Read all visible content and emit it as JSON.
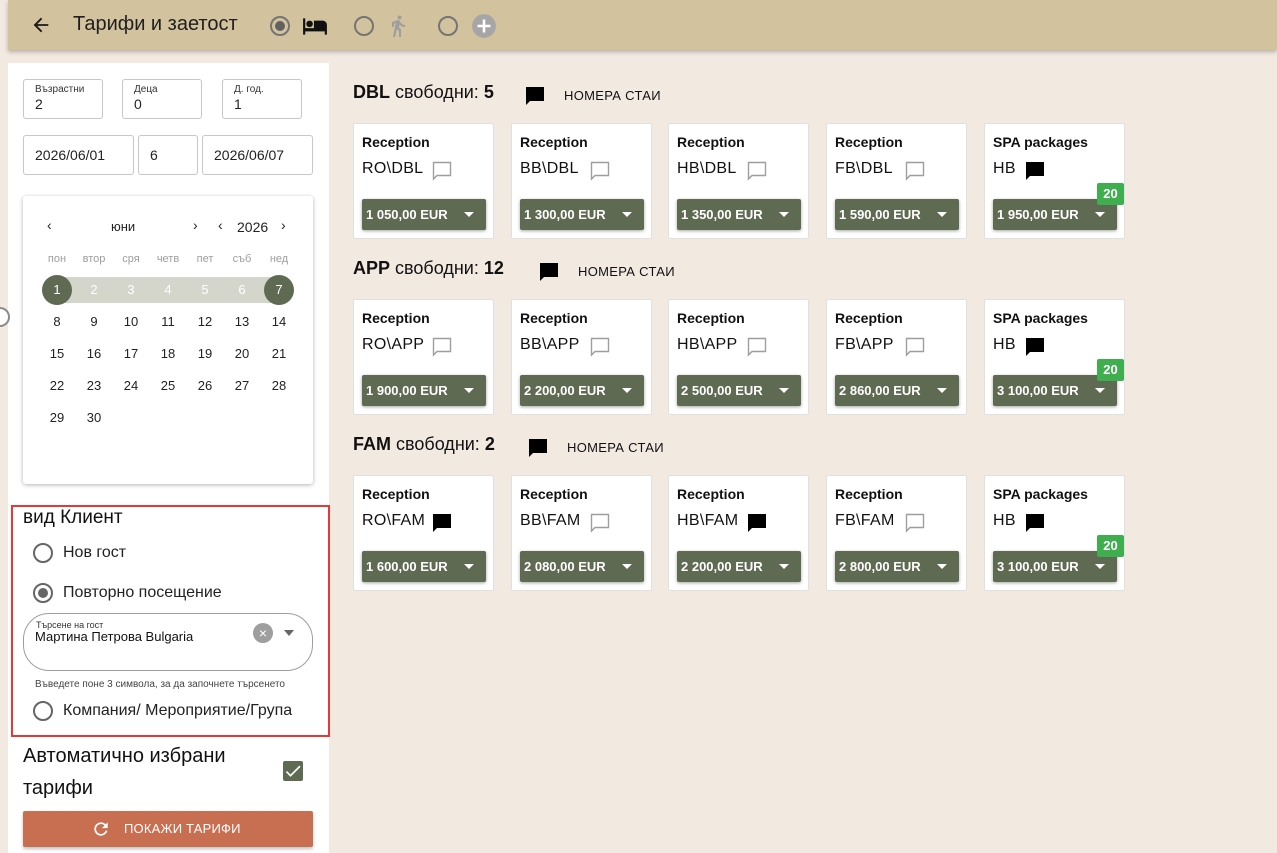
{
  "header": {
    "title": "Тарифи и заетост",
    "modes": [
      {
        "name": "hotel",
        "icon": "bed-icon",
        "selected": true
      },
      {
        "name": "walk-in",
        "icon": "walking-person-icon",
        "selected": false
      },
      {
        "name": "add",
        "icon": "add-circle-icon",
        "selected": false
      }
    ]
  },
  "guests": {
    "adults_label": "Възрастни",
    "adults": "2",
    "children_label": "Деца",
    "children": "0",
    "extra_label": "Д. год.",
    "extra": "1"
  },
  "dates": {
    "from": "2026/06/01",
    "nights": "6",
    "to": "2026/06/07"
  },
  "calendar": {
    "month": "юни",
    "year": "2026",
    "weekdays": [
      "пон",
      "втор",
      "сря",
      "четв",
      "пет",
      "съб",
      "нед"
    ],
    "days": [
      "1",
      "2",
      "3",
      "4",
      "5",
      "6",
      "7",
      "8",
      "9",
      "10",
      "11",
      "12",
      "13",
      "14",
      "15",
      "16",
      "17",
      "18",
      "19",
      "20",
      "21",
      "22",
      "23",
      "24",
      "25",
      "26",
      "27",
      "28",
      "29",
      "30"
    ],
    "selected_start": "1",
    "selected_end": "7"
  },
  "client": {
    "title": "вид Клиент",
    "option_new": "Нов гост",
    "option_repeat": "Повторно посещение",
    "option_company": "Компания/ Мероприятие/Група",
    "selected": "repeat",
    "search_label": "Търсене на гост",
    "search_value": "Мартина Петрова Bulgaria",
    "hint": "Въведете поне 3 символа, за да започнете търсенето"
  },
  "auto_rates": {
    "label": "Автоматично избрани тарифи",
    "checked": true
  },
  "show_button": "ПОКАЖИ ТАРИФИ",
  "rooms": [
    {
      "code": "DBL",
      "free_label": "свободни:",
      "free": "5",
      "rooms_link": "НОМЕРА СТАИ",
      "rates": [
        {
          "source": "Reception",
          "rate": "RO\\DBL",
          "price": "1 050,00 EUR",
          "note": false
        },
        {
          "source": "Reception",
          "rate": "BB\\DBL",
          "price": "1 300,00 EUR",
          "note": false
        },
        {
          "source": "Reception",
          "rate": "HB\\DBL",
          "price": "1 350,00 EUR",
          "note": false
        },
        {
          "source": "Reception",
          "rate": "FB\\DBL",
          "price": "1 590,00 EUR",
          "note": false
        },
        {
          "source": "SPA packages",
          "rate": "HB",
          "price": "1 950,00 EUR",
          "note": true,
          "badge": "20"
        }
      ]
    },
    {
      "code": "APP",
      "free_label": "свободни:",
      "free": "12",
      "rooms_link": "НОМЕРА СТАИ",
      "rates": [
        {
          "source": "Reception",
          "rate": "RO\\APP",
          "price": "1 900,00 EUR",
          "note": false
        },
        {
          "source": "Reception",
          "rate": "BB\\APP",
          "price": "2 200,00 EUR",
          "note": false
        },
        {
          "source": "Reception",
          "rate": "HB\\APP",
          "price": "2 500,00 EUR",
          "note": false
        },
        {
          "source": "Reception",
          "rate": "FB\\APP",
          "price": "2 860,00 EUR",
          "note": false
        },
        {
          "source": "SPA packages",
          "rate": "HB",
          "price": "3 100,00 EUR",
          "note": true,
          "badge": "20"
        }
      ]
    },
    {
      "code": "FAM",
      "free_label": "свободни:",
      "free": "2",
      "rooms_link": "НОМЕРА СТАИ",
      "rates": [
        {
          "source": "Reception",
          "rate": "RO\\FAM",
          "price": "1 600,00 EUR",
          "note": true
        },
        {
          "source": "Reception",
          "rate": "BB\\FAM",
          "price": "2 080,00 EUR",
          "note": false
        },
        {
          "source": "Reception",
          "rate": "HB\\FAM",
          "price": "2 200,00 EUR",
          "note": true
        },
        {
          "source": "Reception",
          "rate": "FB\\FAM",
          "price": "2 800,00 EUR",
          "note": false
        },
        {
          "source": "SPA packages",
          "rate": "HB",
          "price": "3 100,00 EUR",
          "note": true,
          "badge": "20"
        }
      ]
    }
  ],
  "colors": {
    "topbar": "#d2c29e",
    "background": "#f2e9e1",
    "accent_green": "#5f6a52",
    "badge_green": "#3fae4f",
    "button_orange": "#c86f52",
    "highlight_red": "#e53935"
  }
}
